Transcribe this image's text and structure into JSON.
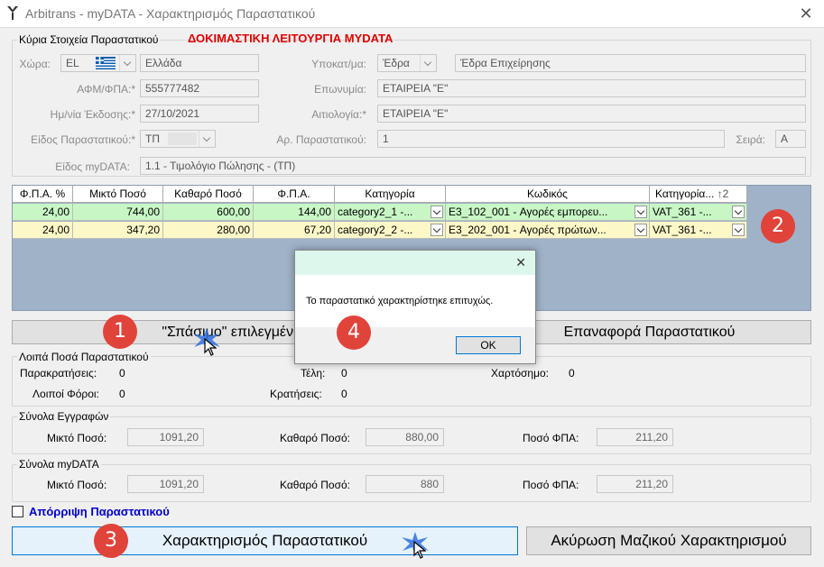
{
  "window": {
    "title": "Arbitrans - myDATA - Χαρακτηρισμός Παραστατικού",
    "close_glyph": "✕"
  },
  "main_info": {
    "group_title": "Κύρια Στοιχεία Παραστατικού",
    "test_mode_label": "ΔΟΚΙΜΑΣΤΙΚΗ ΛΕΙΤΟΥΡΓΙΑ MYDATA",
    "test_mode_color": "#e00000",
    "country_label": "Χώρα:",
    "country_code": "EL",
    "country_name": "Ελλάδα",
    "vat_label": "ΑΦΜ/ΦΠΑ:*",
    "vat_value": "555777482",
    "issue_date_label": "Ημ/νία Έκδοσης:*",
    "issue_date_value": "27/10/2021",
    "doc_type_label": "Είδος Παραστατικού:*",
    "doc_type_value": "ΤΠ",
    "mydata_type_label": "Είδος myDATA:",
    "mydata_type_value": "1.1 - Τιμολόγιο Πώλησης - (ΤΠ)",
    "branch_label": "Υποκατ/μα:",
    "branch_code": "Έδρα",
    "branch_name": "Έδρα Επιχείρησης",
    "company_label": "Επωνυμία:",
    "company_value": "ΕΤΑΙΡΕΙΑ \"Ε\"",
    "reason_label": "Αιτιολογία:*",
    "reason_value": "ΕΤΑΙΡΕΙΑ \"Ε\"",
    "doc_number_label": "Αρ. Παραστατικού:",
    "doc_number_value": "1",
    "series_label": "Σειρά:",
    "series_value": "A"
  },
  "grid": {
    "columns": [
      "Φ.Π.Α. %",
      "Μικτό Ποσό",
      "Καθαρό Ποσό",
      "Φ.Π.Α.",
      "Κατηγορία",
      "Κωδικός",
      "Κατηγορία..."
    ],
    "sort_indicator": "↑2",
    "rows": [
      {
        "vat_pct": "24,00",
        "gross": "744,00",
        "net": "600,00",
        "vat": "144,00",
        "category": "category2_1  -...",
        "code": "E3_102_001  -  Αγορές εμπορευ...",
        "vat_category": "VAT_361  -...",
        "color": "#c8f7c5"
      },
      {
        "vat_pct": "24,00",
        "gross": "347,20",
        "net": "280,00",
        "vat": "67,20",
        "category": "category2_2  -...",
        "code": "E3_202_001  -  Αγορές πρώτων...",
        "vat_category": "VAT_361  -...",
        "color": "#fcf8c8"
      }
    ]
  },
  "buttons": {
    "split_label": "\"Σπάσιμο\" επιλεγμένης",
    "restore_label": "Επαναφορά Παραστατικού",
    "characterize_label": "Χαρακτηρισμός Παραστατικού",
    "cancel_bulk_label": "Ακύρωση Μαζικού Χαρακτηρισμού"
  },
  "other_amounts": {
    "group_title": "Λοιπά Ποσά Παραστατικού",
    "withholdings_label": "Παρακρατήσεις:",
    "withholdings_value": "0",
    "fees_label": "Τέλη:",
    "fees_value": "0",
    "stamp_label": "Χαρτόσημο:",
    "stamp_value": "0",
    "other_taxes_label": "Λοιποί Φόροι:",
    "other_taxes_value": "0",
    "deductions_label": "Κρατήσεις:",
    "deductions_value": "0"
  },
  "record_totals": {
    "group_title": "Σύνολα Εγγραφών",
    "gross_label": "Μικτό Ποσό:",
    "gross_value": "1091,20",
    "net_label": "Καθαρό Ποσό:",
    "net_value": "880,00",
    "vat_label": "Ποσό ΦΠΑ:",
    "vat_value": "211,20"
  },
  "mydata_totals": {
    "group_title": "Σύνολα myDATA",
    "gross_label": "Μικτό Ποσό:",
    "gross_value": "1091,20",
    "net_label": "Καθαρό Ποσό:",
    "net_value": "880",
    "vat_label": "Ποσό ΦΠΑ:",
    "vat_value": "211,20"
  },
  "reject": {
    "label": "Απόρριψη Παραστατικού",
    "checked": false,
    "color": "#0000cc"
  },
  "dialog": {
    "message": "Το παραστατικό χαρακτηρίστηκε επιτυχώς.",
    "ok_label": "OK",
    "close_glyph": "✕"
  },
  "badges": [
    "1",
    "2",
    "3",
    "4"
  ]
}
